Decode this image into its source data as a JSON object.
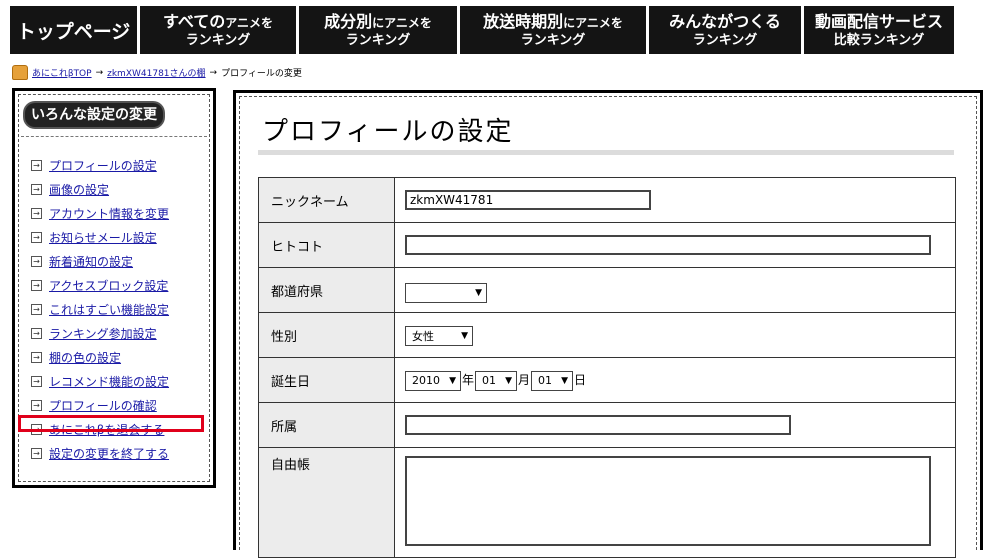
{
  "nav": [
    {
      "id": "top",
      "single": "トップページ"
    },
    {
      "id": "all",
      "l1a": "すべての",
      "l1b": "アニメを",
      "l2": "ランキング"
    },
    {
      "id": "component",
      "l1a": "成分別",
      "l1b": "にアニメを",
      "l2": "ランキング"
    },
    {
      "id": "broadcast",
      "l1a": "放送時期別",
      "l1b": "にアニメを",
      "l2": "ランキング"
    },
    {
      "id": "everyone",
      "l1a": "みんながつくる",
      "l1b": "",
      "l2": "ランキング"
    },
    {
      "id": "streaming",
      "l1a": "動画配信サービス",
      "l1b": "",
      "l2": "比較ランキング"
    }
  ],
  "breadcrumb": {
    "home_link": "あにこれβTOP",
    "sep1": "→",
    "user_link": "zkmXW41781さんの棚",
    "sep2": "→",
    "current": "プロフィールの変更"
  },
  "sidebar": {
    "title": "いろんな設定の変更",
    "items": [
      {
        "label": "プロフィールの設定"
      },
      {
        "label": "画像の設定"
      },
      {
        "label": "アカウント情報を変更"
      },
      {
        "label": "お知らせメール設定"
      },
      {
        "label": "新着通知の設定"
      },
      {
        "label": "アクセスブロック設定"
      },
      {
        "label": "これはすごい機能設定"
      },
      {
        "label": "ランキング参加設定"
      },
      {
        "label": "棚の色の設定"
      },
      {
        "label": "レコメンド機能の設定"
      },
      {
        "label": "プロフィールの確認"
      },
      {
        "label": "あにこれβを退会する"
      },
      {
        "label": "設定の変更を終了する"
      }
    ],
    "highlighted_item": "あにこれβを退会する",
    "highlight_color": "#e0001b"
  },
  "main": {
    "title": "プロフィールの設定",
    "fields": {
      "nickname": {
        "label": "ニックネーム",
        "value": "zkmXW41781"
      },
      "hitokoto": {
        "label": "ヒトコト",
        "value": ""
      },
      "prefecture": {
        "label": "都道府県",
        "value": ""
      },
      "gender": {
        "label": "性別",
        "value": "女性"
      },
      "birthday": {
        "label": "誕生日",
        "year": "2010",
        "year_unit": "年",
        "month": "01",
        "month_unit": "月",
        "day": "01",
        "day_unit": "日"
      },
      "affiliation": {
        "label": "所属",
        "value": ""
      },
      "freenote": {
        "label": "自由帳",
        "value": ""
      }
    }
  },
  "icons": {
    "breadcrumb_home": "home-icon",
    "sidebar_bullet": "arrow-box-icon",
    "select_caret": "triangle-down-icon"
  },
  "colors": {
    "nav_bg": "#141414",
    "link": "#1a1aa6",
    "label_bg": "#ececec"
  }
}
